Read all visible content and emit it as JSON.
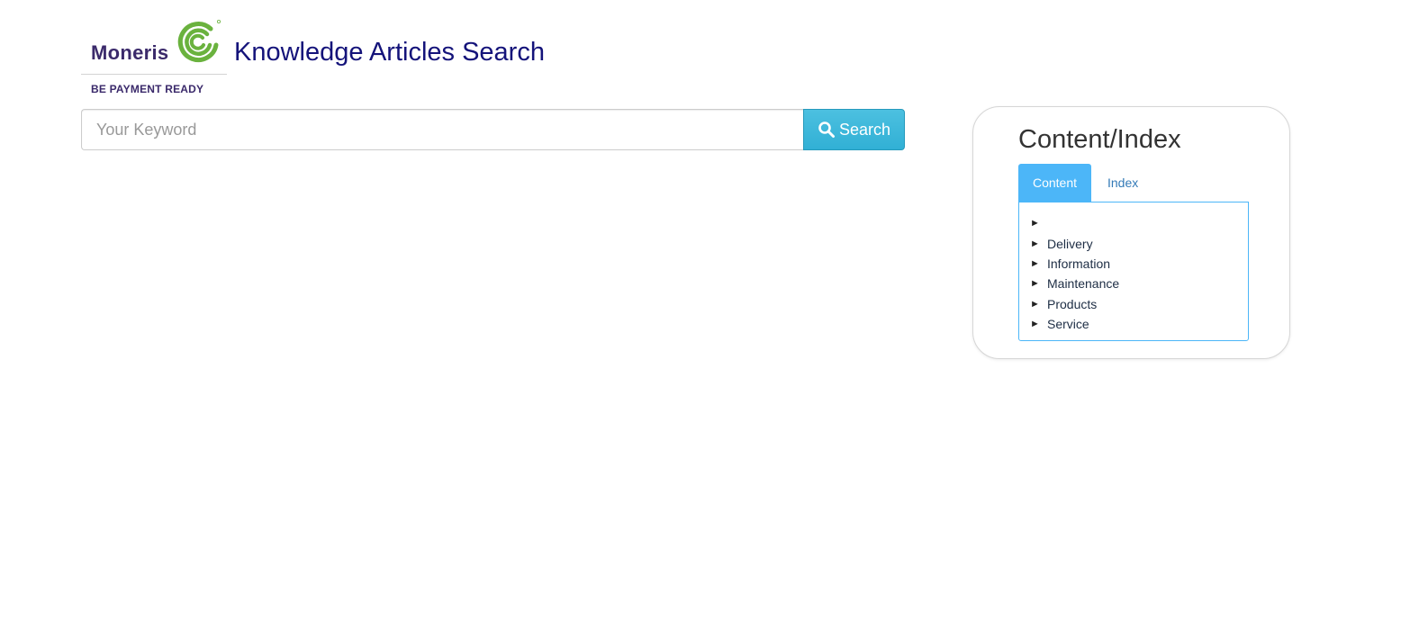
{
  "header": {
    "logo": {
      "wordmark": "Moneris",
      "tagline": "BE PAYMENT READY",
      "icon": "moneris-swirl-logo",
      "brand_purple": "#3b2a6b",
      "brand_green": "#6ab23e"
    },
    "title": "Knowledge Articles Search",
    "title_color": "#14137a"
  },
  "search": {
    "placeholder": "Your Keyword",
    "value": "",
    "button_label": "Search",
    "button_icon": "search-icon",
    "button_color": "#31b0d5"
  },
  "panel": {
    "title": "Content/Index",
    "tabs": [
      {
        "label": "Content",
        "active": true
      },
      {
        "label": "Index",
        "active": false
      }
    ],
    "accent_color": "#4cb6f8",
    "tree": {
      "arrow": "►",
      "items": [
        {
          "label": ""
        },
        {
          "label": "Delivery"
        },
        {
          "label": "Information"
        },
        {
          "label": "Maintenance"
        },
        {
          "label": "Products"
        },
        {
          "label": "Service"
        }
      ]
    }
  }
}
